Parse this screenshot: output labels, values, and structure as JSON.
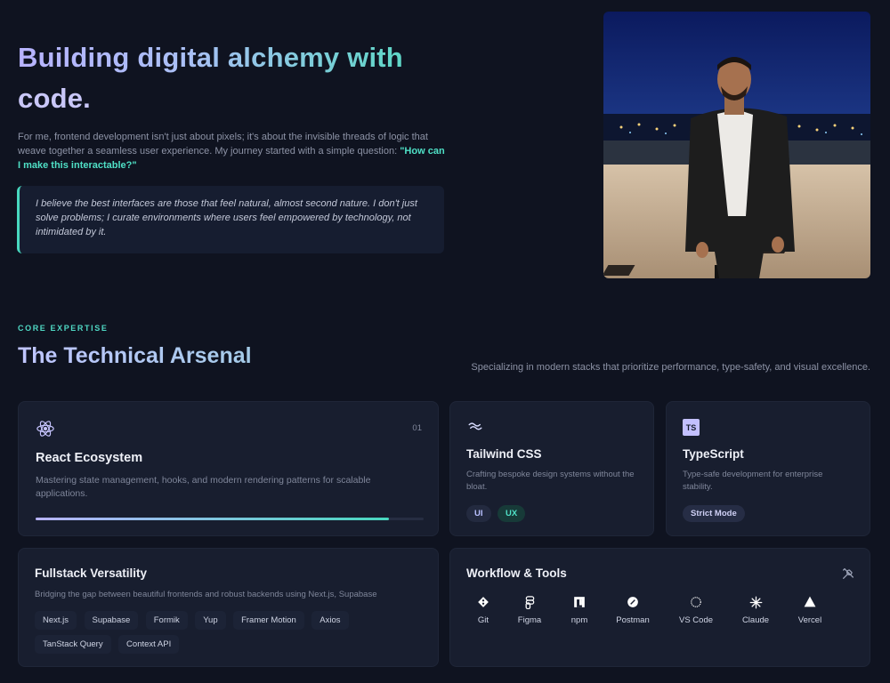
{
  "hero": {
    "title_part1": "Building digital alchemy with",
    "title_part2": "code.",
    "intro_text": "For me, frontend development isn't just about pixels; it's about the invisible threads of logic that weave together a seamless user experience. My journey started with a simple question: ",
    "intro_highlight": "\"How can I make this interactable?\"",
    "quote": "I believe the best interfaces are those that feel natural, almost second nature. I don't just solve problems; I curate environments where users feel empowered by technology, not intimidated by it."
  },
  "expertise": {
    "eyebrow": "CORE EXPERTISE",
    "title": "The Technical Arsenal",
    "subtitle": "Specializing in modern stacks that prioritize performance, type-safety, and visual excellence."
  },
  "cards": {
    "react": {
      "title": "React Ecosystem",
      "number": "01",
      "desc": "Mastering state management, hooks, and modern rendering patterns for scalable applications.",
      "progress": 0.91
    },
    "tailwind": {
      "title": "Tailwind CSS",
      "desc": "Crafting bespoke design systems without the bloat.",
      "tags": [
        "UI",
        "UX"
      ]
    },
    "typescript": {
      "title": "TypeScript",
      "badge": "TS",
      "desc": "Type-safe development for enterprise stability.",
      "tags": [
        "Strict Mode"
      ]
    },
    "fullstack": {
      "title": "Fullstack Versatility",
      "desc": "Bridging the gap between beautiful frontends and robust backends using Next.js, Supabase",
      "chips": [
        "Next.js",
        "Supabase",
        "Formik",
        "Yup",
        "Framer Motion",
        "Axios",
        "TanStack Query",
        "Context API"
      ]
    },
    "workflow": {
      "title": "Workflow & Tools",
      "tools": [
        "Git",
        "Figma",
        "npm",
        "Postman",
        "VS Code",
        "Claude",
        "Vercel"
      ]
    }
  },
  "colors": {
    "background": "#0f1320",
    "card": "#181e2f",
    "accent_teal": "#48d8bf",
    "accent_lavender": "#b8b3ff"
  }
}
